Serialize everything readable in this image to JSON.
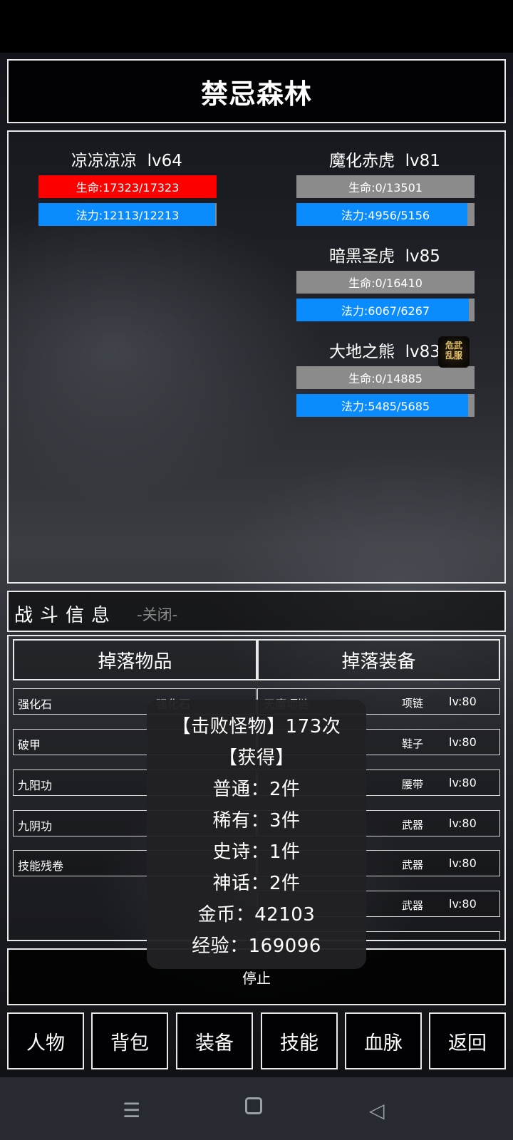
{
  "map_title": "禁忌森林",
  "player": {
    "name": "凉凉凉凉",
    "level": "lv64",
    "hp_text": "生命:17323/17323",
    "mp_text": "法力:12113/12213",
    "hp_ratio": 1.0,
    "mp_ratio": 0.992
  },
  "enemies": [
    {
      "name": "魔化赤虎",
      "level": "lv81",
      "hp_text": "生命:0/13501",
      "mp_text": "法力:4956/5156",
      "hp_ratio": 0,
      "mp_ratio": 0.961
    },
    {
      "name": "暗黑圣虎",
      "level": "lv85",
      "hp_text": "生命:0/16410",
      "mp_text": "法力:6067/6267",
      "hp_ratio": 0,
      "mp_ratio": 0.968
    },
    {
      "name": "大地之熊",
      "level": "lv83",
      "hp_text": "生命:0/14885",
      "mp_text": "法力:5485/5685",
      "hp_ratio": 0,
      "mp_ratio": 0.965
    }
  ],
  "seal_text": "危武乱服",
  "battle_info": {
    "label": "战斗信息",
    "close_label": "-关闭-"
  },
  "tabs": {
    "items": "掉落物品",
    "equipment": "掉落装备"
  },
  "drop_items": [
    {
      "name": "强化石",
      "extra": "强化石"
    },
    {
      "name": "破甲",
      "extra": ""
    },
    {
      "name": "九阳功",
      "extra": ""
    },
    {
      "name": "九阴功",
      "extra": ""
    },
    {
      "name": "技能残卷",
      "extra": ""
    }
  ],
  "drop_equipment": [
    {
      "name": "天魔项链",
      "type": "项链",
      "level": "lv:80"
    },
    {
      "name": "",
      "type": "鞋子",
      "level": "lv:80"
    },
    {
      "name": "",
      "type": "腰带",
      "level": "lv:80"
    },
    {
      "name": "",
      "type": "武器",
      "level": "lv:80"
    },
    {
      "name": "",
      "type": "武器",
      "level": "lv:80"
    },
    {
      "name": "",
      "type": "武器",
      "level": "lv:80"
    }
  ],
  "popup": {
    "defeated": "【击败怪物】173次",
    "obtained": "【获得】",
    "normal": "普通：2件",
    "rare": "稀有：3件",
    "epic": "史诗：1件",
    "myth": "神话：2件",
    "gold": "金币：42103",
    "exp": "经验：169096"
  },
  "stop_label": "停止",
  "nav": [
    "人物",
    "背包",
    "装备",
    "技能",
    "血脉",
    "返回"
  ],
  "colors": {
    "hp": "#fc0000",
    "mp": "#0a8cff",
    "empty": "#8b8b8b"
  },
  "system_nav_icons": [
    "menu-icon",
    "home-square-icon",
    "back-triangle-icon"
  ]
}
